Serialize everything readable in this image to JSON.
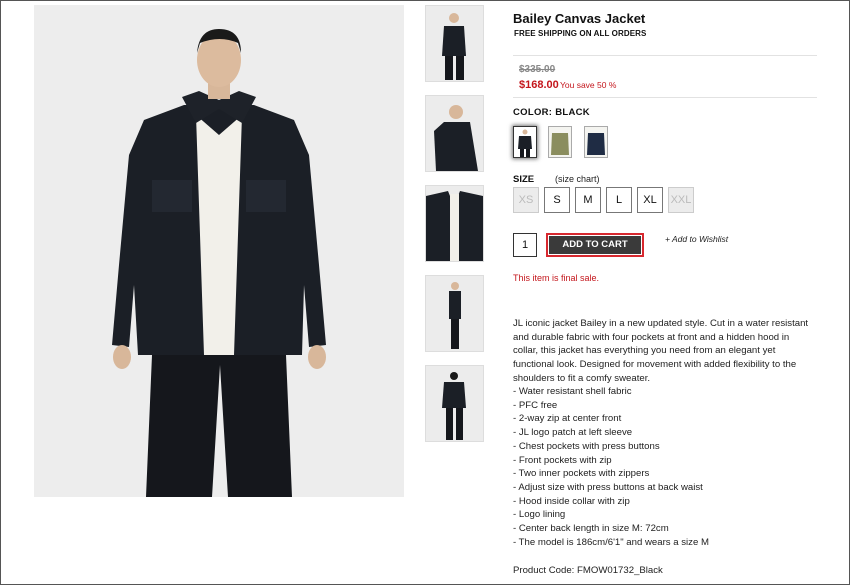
{
  "product": {
    "title": "Bailey Canvas Jacket",
    "shipping_note": "FREE SHIPPING ON ALL ORDERS",
    "original_price": "$335.00",
    "sale_price": "$168.00",
    "savings_text": "You save 50 %",
    "color_label": "COLOR: BLACK",
    "colors": [
      {
        "name": "black",
        "hex": "#1b1f26",
        "selected": true
      },
      {
        "name": "olive",
        "hex": "#8a8d5e",
        "selected": false
      },
      {
        "name": "navy",
        "hex": "#1f2c44",
        "selected": false
      }
    ],
    "size_label": "SIZE",
    "size_chart_label": "(size chart)",
    "sizes": [
      {
        "label": "XS",
        "available": false
      },
      {
        "label": "S",
        "available": true
      },
      {
        "label": "M",
        "available": true
      },
      {
        "label": "L",
        "available": true
      },
      {
        "label": "XL",
        "available": true
      },
      {
        "label": "XXL",
        "available": false
      }
    ],
    "quantity": "1",
    "add_to_cart_label": "ADD TO CART",
    "wishlist_label": "+ Add to Wishlist",
    "final_sale_text": "This item is final sale.",
    "description_lines": [
      "JL iconic jacket Bailey in a new updated style. Cut in a water resistant",
      "and durable fabric with four pockets at front and a hidden hood in",
      "collar, this jacket has everything you need from an elegant yet",
      "functional look. Designed for movement with added flexibility to the",
      "shoulders to fit a comfy sweater."
    ],
    "features": [
      "- Water resistant shell fabric",
      "- PFC free",
      "- 2-way zip at center front",
      "- JL logo patch at left sleeve",
      "- Chest pockets with press buttons",
      "- Front pockets with zip",
      "- Two inner pockets with zippers",
      "- Adjust size with press buttons at back waist",
      "- Hood inside collar with zip",
      "- Logo lining",
      "- Center back length in size M: 72cm",
      "- The model is 186cm/6'1\" and wears a size M"
    ],
    "product_code_label": "Product Code:",
    "product_code": "FMOW01732_Black"
  },
  "images": {
    "main_alt": "model wearing black jacket front view",
    "thumbnails": [
      "front view",
      "side hooded view",
      "detail view",
      "side profile",
      "back view"
    ]
  },
  "colors": {
    "sale_red": "#c4161c",
    "cart_button": "#3a3a3a",
    "cart_outline": "#d7282f",
    "jacket": "#1b1f26"
  }
}
